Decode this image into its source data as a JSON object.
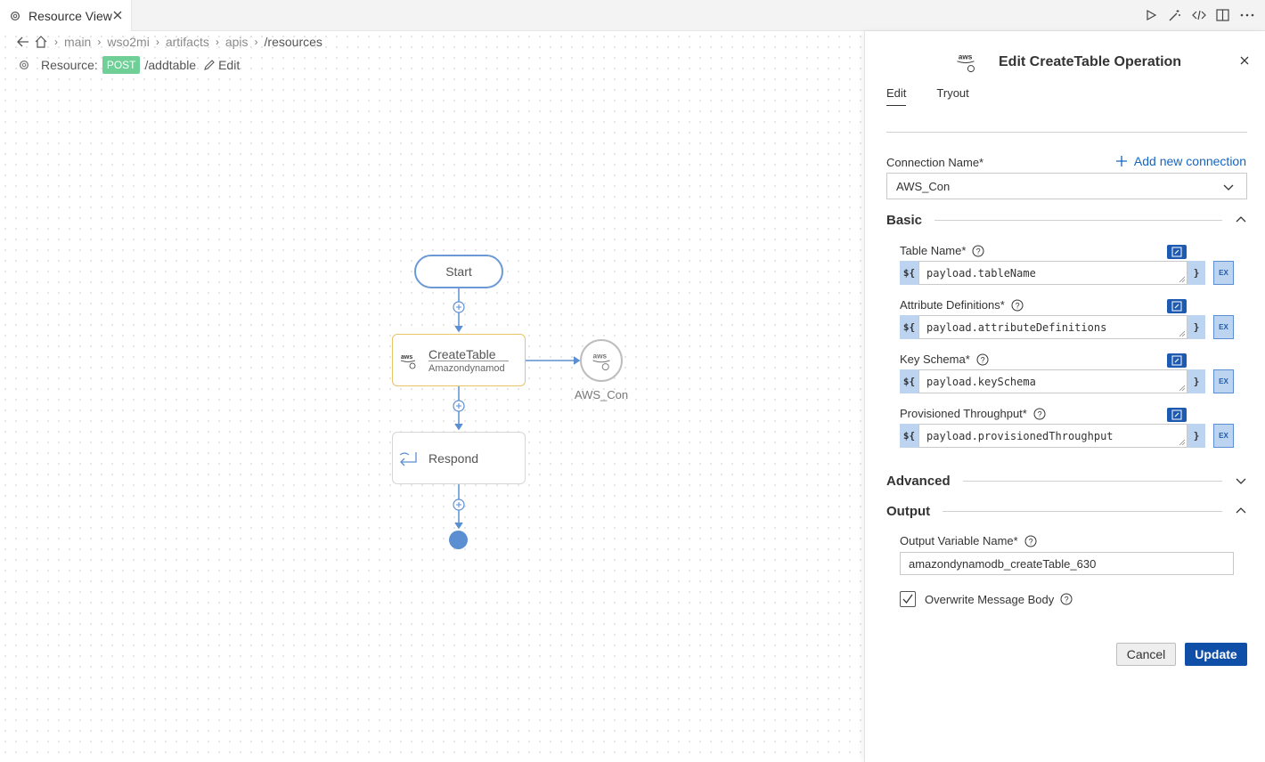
{
  "tab": {
    "title": "Resource View",
    "icon": "gear-icon",
    "close_icon": "close-icon"
  },
  "toolbar": {
    "icons": [
      "run-icon",
      "magic-wand-icon",
      "code-icon",
      "split-editor-icon",
      "more-icon"
    ]
  },
  "breadcrumb": {
    "items": [
      "main",
      "wso2mi",
      "artifacts",
      "apis",
      "/resources"
    ]
  },
  "resource": {
    "label": "Resource:",
    "method": "POST",
    "path": "/addtable",
    "edit_label": "Edit"
  },
  "diagram": {
    "start_label": "Start",
    "connector_node": {
      "title": "CreateTable",
      "subtitle": "Amazondynamod"
    },
    "respond_label": "Respond",
    "connection_label": "AWS_Con",
    "logo_text": "aws"
  },
  "panel": {
    "title": "Edit CreateTable Operation",
    "tabs": [
      "Edit",
      "Tryout"
    ],
    "connection_name_label": "Connection Name*",
    "add_connection_label": "Add new connection",
    "connection_value": "AWS_Con",
    "sections": {
      "basic": "Basic",
      "advanced": "Advanced",
      "output": "Output"
    },
    "fields": [
      {
        "label": "Table Name*",
        "value": "payload.tableName"
      },
      {
        "label": "Attribute Definitions*",
        "value": "payload.attributeDefinitions"
      },
      {
        "label": "Key Schema*",
        "value": "payload.keySchema"
      },
      {
        "label": "Provisioned Throughput*",
        "value": "payload.provisionedThroughput"
      }
    ],
    "expr_prefix": "${",
    "expr_suffix": "}",
    "ex_label": "EX",
    "output_variable_label": "Output Variable Name*",
    "output_variable_value": "amazondynamodb_createTable_630",
    "overwrite_label": "Overwrite Message Body",
    "overwrite_checked": true,
    "cancel_label": "Cancel",
    "update_label": "Update"
  },
  "colors": {
    "accent": "#0f4fa8",
    "post_badge": "#6fcf97",
    "node_highlight": "#e7c468",
    "flow_line": "#5b8fd1"
  }
}
